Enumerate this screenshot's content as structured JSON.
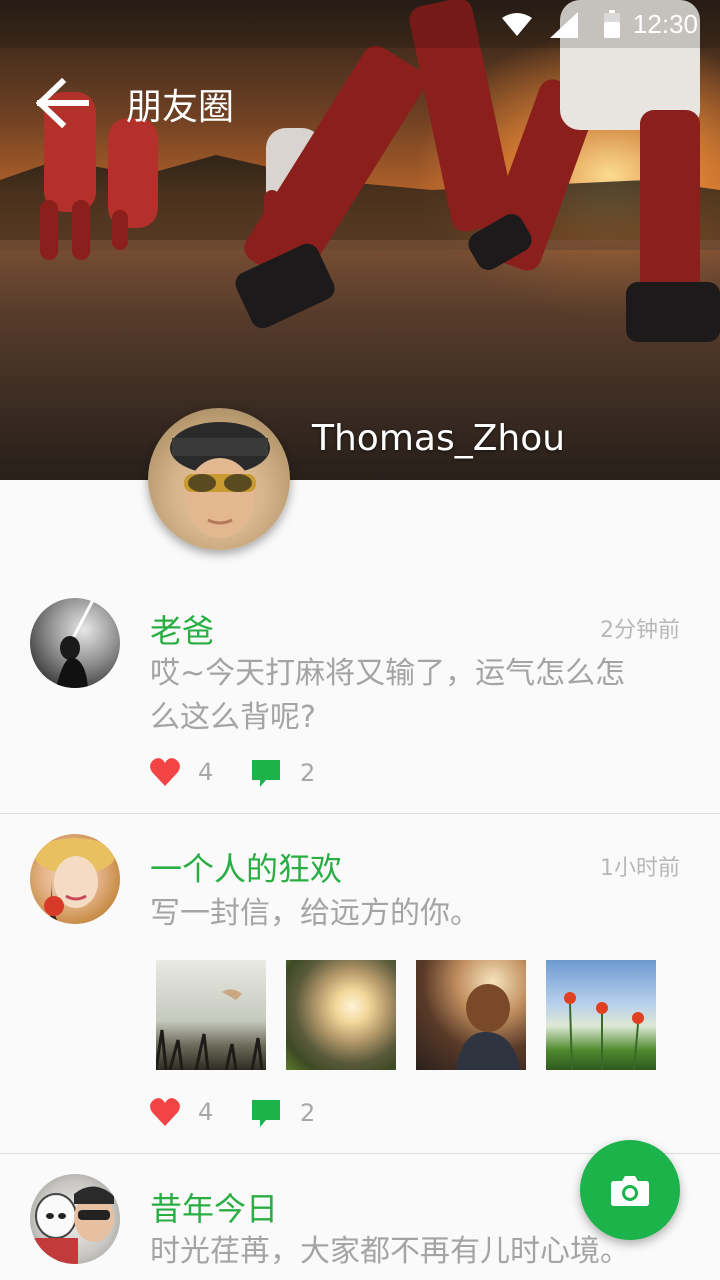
{
  "status_bar": {
    "time": "12:30"
  },
  "app_bar": {
    "title": "朋友圈"
  },
  "profile": {
    "name": "Thomas_Zhou"
  },
  "posts": [
    {
      "author": "老爸",
      "time": "2分钟前",
      "text": "哎~今天打麻将又输了，运气怎么怎么这么背呢?",
      "likes": "4",
      "comments": "2"
    },
    {
      "author": "一个人的狂欢",
      "time": "1小时前",
      "text": "写一封信，给远方的你。",
      "likes": "4",
      "comments": "2"
    },
    {
      "author": "昔年今日",
      "text": "时光荏苒，大家都不再有儿时心境。"
    }
  ],
  "colors": {
    "accent": "#2aae44",
    "fab": "#1bb34a",
    "heart": "#f24444",
    "comment": "#1bb34a"
  },
  "icons": {
    "back": "arrow-left-icon",
    "like": "heart-icon",
    "comment": "comment-icon",
    "camera": "camera-icon"
  }
}
